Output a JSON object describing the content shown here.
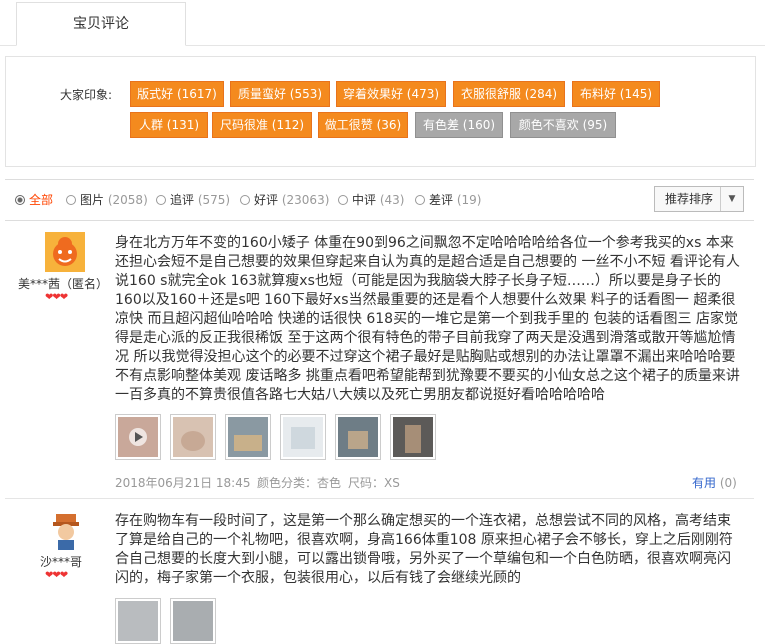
{
  "tabs": {
    "active_label": "宝贝评论"
  },
  "impressions": {
    "label": "大家印象:",
    "tags": [
      {
        "text": "版式好 (1617)",
        "style": "orange"
      },
      {
        "text": "质量蛮好 (553)",
        "style": "orange"
      },
      {
        "text": "穿着效果好 (473)",
        "style": "orange"
      },
      {
        "text": "衣服很舒服 (284)",
        "style": "orange"
      },
      {
        "text": "布料好 (145)",
        "style": "orange"
      },
      {
        "text": "人群 (131)",
        "style": "orange"
      },
      {
        "text": "尺码很准 (112)",
        "style": "orange"
      },
      {
        "text": "做工很赞 (36)",
        "style": "orange"
      },
      {
        "text": "有色差 (160)",
        "style": "gray"
      },
      {
        "text": "颜色不喜欢 (95)",
        "style": "gray"
      }
    ]
  },
  "filters": {
    "options": [
      {
        "label": "全部",
        "count": ""
      },
      {
        "label": "图片",
        "count": "(2058)"
      },
      {
        "label": "追评",
        "count": "(575)"
      },
      {
        "label": "好评",
        "count": "(23063)"
      },
      {
        "label": "中评",
        "count": "(43)"
      },
      {
        "label": "差评",
        "count": "(19)"
      }
    ],
    "selected": "全部",
    "sort_label": "推荐排序"
  },
  "reviews": [
    {
      "user": "美***茜（匿名）",
      "hearts": "❤❤❤",
      "content": "身在北方万年不变的160小矮子 体重在90到96之间飘忽不定哈哈哈哈给各位一个参考我买的xs 本来还担心会短不是自己想要的效果但穿起来自认为真的是超合适是自己想要的 一丝不小不短 看评论有人说160 s就完全ok 163就算瘦xs也短（可能是因为我脑袋大脖子长身子短……）所以要是身子长的160以及160＋还是s吧 160下最好xs当然最重要的还是看个人想要什么效果 料子的话看图一 超柔很凉快 而且超闪超仙哈哈哈 快递的话很快 618买的一堆它是第一个到我手里的 包装的话看图三 店家觉得是走心派的反正我很稀饭 至于这两个很有特色的带子目前我穿了两天是没遇到滑落或散开等尴尬情况 所以我觉得没担心这个的必要不过穿这个裙子最好是贴胸贴或想别的办法让罩罩不漏出来哈哈哈要不有点影响整体美观 废话略多 挑重点看吧希望能帮到犹豫要不要买的小仙女总之这个裙子的质量来讲一百多真的不算贵很值各路七大姑八大姨以及死亡男朋友都说挺好看哈哈哈哈哈",
      "date": "2018年06月21日 18:45",
      "color": "颜色分类：杏色",
      "size": "尺码：XS",
      "useful_label": "有用",
      "useful_count": "(0)"
    },
    {
      "user": "沙***哥",
      "hearts": "❤❤❤",
      "content": "存在购物车有一段时间了，这是第一个那么确定想买的一个连衣裙，总想尝试不同的风格，高考结束了算是给自己的一个礼物吧，很喜欢啊，身高166体重108 原来担心裙子会不够长，穿上之后刚刚符合自己想要的长度大到小腿，可以露出锁骨哦，另外买了一个草编包和一个白色防晒，很喜欢啊亮闪闪的，梅子家第一个衣服，包装很用心，以后有钱了会继续光顾的"
    }
  ],
  "colors": {
    "accent": "#f48a1e",
    "selected_filter": "#ff4400",
    "link": "#3366cc"
  },
  "icons": [
    "avatar-cartoon-icon",
    "avatar-character-icon",
    "heart-icon",
    "play-icon",
    "chevron-down-icon"
  ]
}
